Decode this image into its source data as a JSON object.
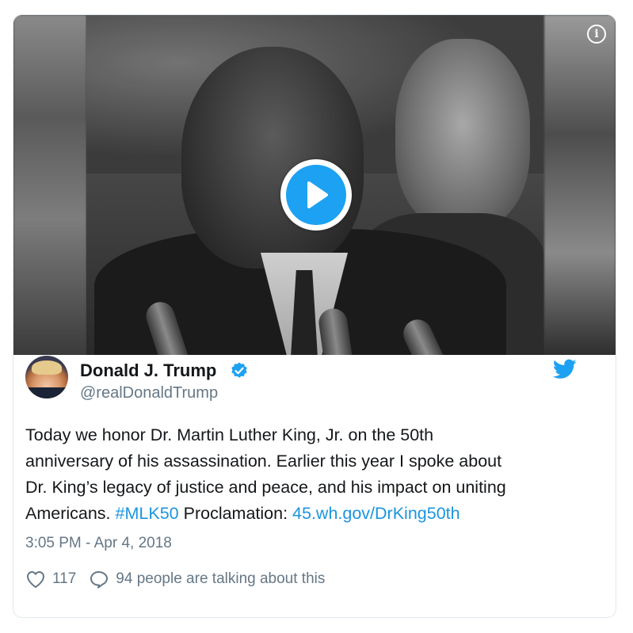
{
  "media": {
    "type": "video",
    "info_icon": "info-icon",
    "play_icon": "play-icon"
  },
  "tweet": {
    "author_name": "Donald J. Trump",
    "verified_icon": "verified-badge-icon",
    "handle": "@realDonaldTrump",
    "platform_icon": "twitter-bird-icon",
    "text_parts": {
      "line_1": "Today we honor Dr. Martin Luther King, Jr. on the 50th",
      "line_2": "anniversary of his assassination. Earlier this year I spoke about",
      "line_3": "Dr. King’s legacy of justice and peace, and his impact on uniting",
      "line_4_prefix": "Americans.",
      "hashtag": "#MLK50",
      "line_4_mid": "Proclamation:",
      "url": "45.wh.gov/DrKing50th"
    },
    "timestamp": "3:05 PM - Apr 4, 2018",
    "likes": "117",
    "conversation": "94 people are talking about this"
  },
  "colors": {
    "accent": "#1da1f2",
    "link": "#1b95e0",
    "secondary_text": "#657786",
    "primary_text": "#14171a"
  }
}
